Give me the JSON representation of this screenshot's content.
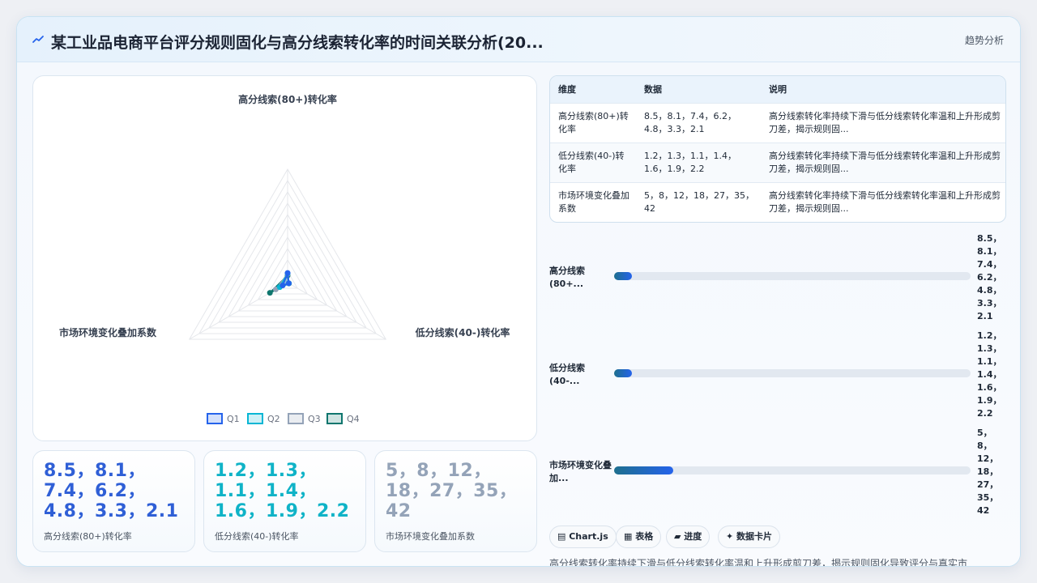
{
  "header": {
    "title": "某工业品电商平台评分规则固化与高分线索转化率的时间关联分析(20...",
    "tag": "趋势分析",
    "icon": "trend-line-icon"
  },
  "chart_data": {
    "type": "radar",
    "axes": [
      "高分线索(80+)转化率",
      "低分线索(40-)转化率",
      "市场环境变化叠加系数"
    ],
    "series": [
      {
        "name": "Q1",
        "values": [
          8.5,
          1.2,
          5
        ],
        "color": "#2563eb"
      },
      {
        "name": "Q2",
        "values": [
          8.1,
          1.3,
          8
        ],
        "color": "#06b6d4"
      },
      {
        "name": "Q3",
        "values": [
          7.4,
          1.1,
          12
        ],
        "color": "#94a3b8"
      },
      {
        "name": "Q4",
        "values": [
          6.2,
          1.4,
          18
        ],
        "color": "#0f766e"
      }
    ],
    "r_range": [
      0,
      100
    ],
    "legend_position": "bottom"
  },
  "kpis": [
    {
      "value": "8.5，8.1，7.4，6.2，4.8，3.3，2.1",
      "label": "高分线索(80+)转化率",
      "color": "#2f5fd6"
    },
    {
      "value": "1.2，1.3，1.1，1.4，1.6，1.9，2.2",
      "label": "低分线索(40-)转化率",
      "color": "#0fb3c7"
    },
    {
      "value": "5，8，12，18，27，35，42",
      "label": "市场环境变化叠加系数",
      "color": "#94a3b8"
    }
  ],
  "table": {
    "headers": [
      "维度",
      "数据",
      "说明"
    ],
    "rows": [
      [
        "高分线索(80+)转化率",
        "8.5，8.1，7.4，6.2，4.8，3.3，2.1",
        "高分线索转化率持续下滑与低分线索转化率温和上升形成剪刀差，揭示规则固..."
      ],
      [
        "低分线索(40-)转化率",
        "1.2，1.3，1.1，1.4，1.6，1.9，2.2",
        "高分线索转化率持续下滑与低分线索转化率温和上升形成剪刀差，揭示规则固..."
      ],
      [
        "市场环境变化叠加系数",
        "5，8，12，18，27，35，42",
        "高分线索转化率持续下滑与低分线索转化率温和上升形成剪刀差，揭示规则固..."
      ]
    ]
  },
  "progress": [
    {
      "label": "高分线索(80+...",
      "value": "8.5，8.1，7.4，6.2，4.8，3.3，2.1",
      "fraction": 0.05
    },
    {
      "label": "低分线索(40-...",
      "value": "1.2，1.3，1.1，1.4，1.6，1.9，2.2",
      "fraction": 0.05
    },
    {
      "label": "市场环境变化叠加...",
      "value": "5，8，12，18，27，35，42",
      "fraction": 0.165
    }
  ],
  "chips": [
    {
      "label": "Chart.js",
      "icon": "chart-icon"
    },
    {
      "label": "表格",
      "icon": "table-icon"
    },
    {
      "label": "进度",
      "icon": "progress-icon"
    },
    {
      "label": "数据卡片",
      "icon": "sparkle-icon"
    }
  ],
  "summary": "高分线索转化率持续下滑与低分线索转化率温和上升形成剪刀差，揭示规则固化导致评分与真实市"
}
